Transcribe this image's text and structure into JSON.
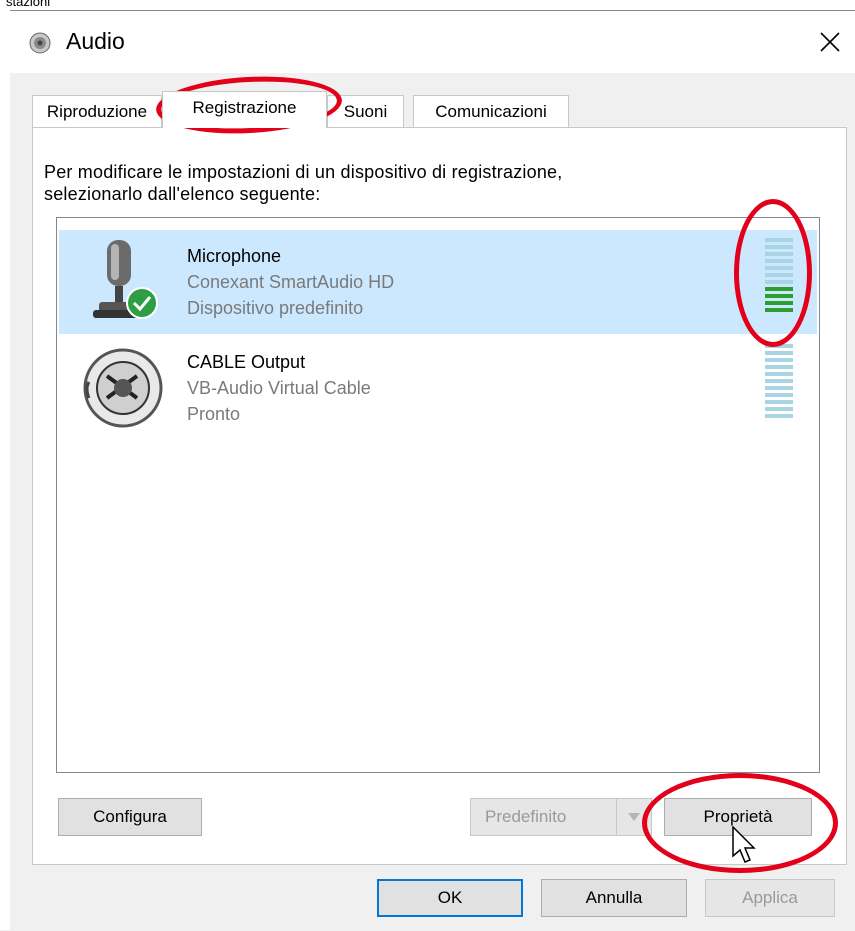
{
  "window": {
    "title": "Audio",
    "title_icon": "speaker-icon",
    "close_icon": "close-icon"
  },
  "tabs": [
    {
      "label": "Riproduzione",
      "active": false
    },
    {
      "label": "Registrazione",
      "active": true
    },
    {
      "label": "Suoni",
      "active": false
    },
    {
      "label": "Comunicazioni",
      "active": false
    }
  ],
  "instructions": {
    "line1": "Per modificare le impostazioni di un dispositivo di registrazione,",
    "line2": "selezionarlo dall'elenco seguente:"
  },
  "devices": [
    {
      "name": "Microphone",
      "description": "Conexant SmartAudio HD",
      "status": "Dispositivo predefinito",
      "icon": "microphone-icon",
      "badge_icon": "check-badge-icon",
      "selected": true,
      "level_fraction": 0.4
    },
    {
      "name": "CABLE Output",
      "description": "VB-Audio Virtual Cable",
      "status": "Pronto",
      "icon": "cable-connector-icon",
      "selected": false,
      "level_fraction": 0
    }
  ],
  "buttons": {
    "configure": "Configura",
    "set_default": "Predefinito",
    "properties": "Proprietà",
    "ok": "OK",
    "cancel": "Annulla",
    "apply": "Applica"
  },
  "colors": {
    "selection": "#cce8ff",
    "annotation": "#e3001b",
    "level_active": "#2e9e2e",
    "level_idle": "#a9d4e4",
    "default_button_border": "#0078d7"
  },
  "page_fragment": "stazioni"
}
